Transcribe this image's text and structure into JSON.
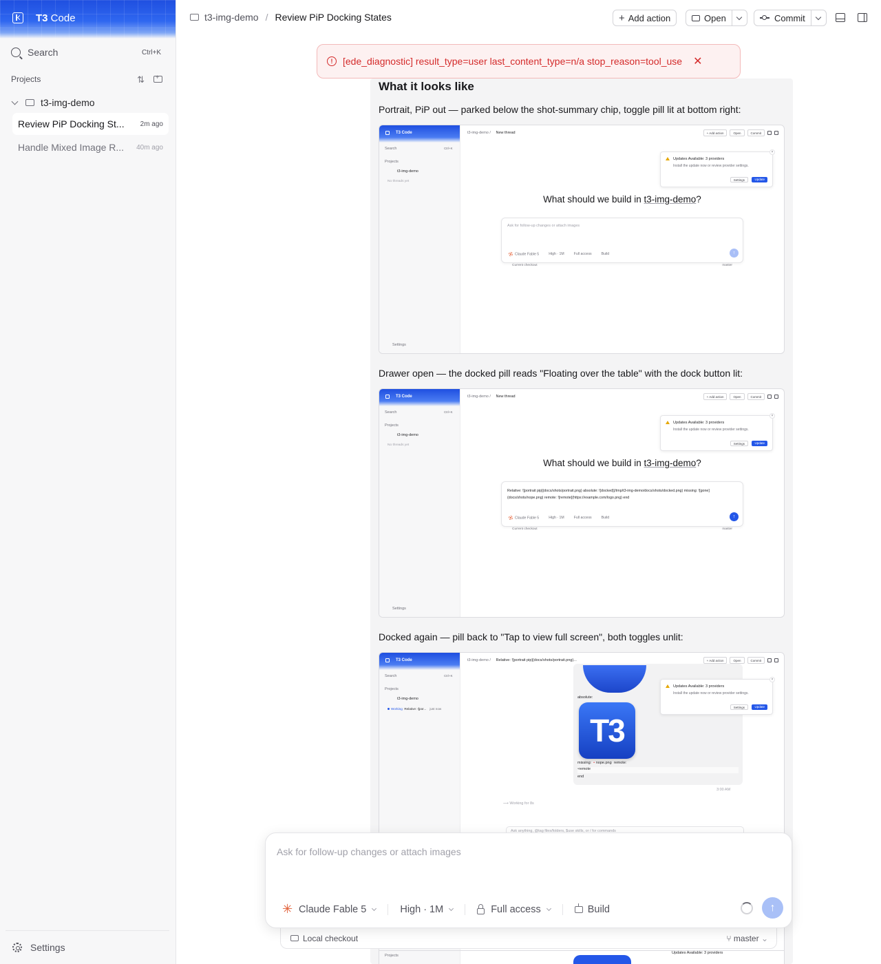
{
  "app": {
    "name_bold": "T3",
    "name_rest": " Code"
  },
  "sidebar": {
    "search_label": "Search",
    "search_shortcut": "Ctrl+K",
    "projects_label": "Projects",
    "project_name": "t3-img-demo",
    "threads": [
      {
        "title": "Review PiP Docking St...",
        "ago": "2m ago",
        "active": true
      },
      {
        "title": "Handle Mixed Image R...",
        "ago": "40m ago",
        "active": false
      }
    ],
    "settings_label": "Settings"
  },
  "header": {
    "crumb_project": "t3-img-demo",
    "crumb_sep": "/",
    "crumb_thread": "Review PiP Docking States",
    "add_action": "Add action",
    "open": "Open",
    "commit": "Commit"
  },
  "banner": {
    "icon": "!",
    "message": "[ede_diagnostic] result_type=user last_content_type=n/a stop_reason=tool_use",
    "close": "✕",
    "color": "#d42a2a"
  },
  "message": {
    "heading": "What it looks like",
    "captions": [
      "Portrait, PiP out — parked below the shot-summary chip, toggle pill lit at bottom right:",
      "Drawer open — the docked pill reads \"Floating over the table\" with the dock button lit:",
      "Docked again — pill back to \"Tap to view full screen\", both toggles unlit:"
    ]
  },
  "mini": {
    "brand": "T3 Code",
    "search": "Search",
    "shortcut": "Ctrl+K",
    "projects": "Projects",
    "project": "t3-img-demo",
    "no_threads": "No threads yet",
    "settings": "Settings",
    "crumb_project": "t3-img-demo",
    "crumb_new": "New thread",
    "crumb_relative": "Relative: ![portrait pip](docs/shots/portrait.png)...",
    "add_action": "+ Add action",
    "open": "Open",
    "commit": "Commit",
    "toast_title": "Updates Available: 3 providers",
    "toast_body": "Install the update now or review provider settings.",
    "toast_settings": "Settings",
    "toast_update": "Update",
    "question_prefix": "What should we build in ",
    "question_project": "t3-img-demo",
    "question_suffix": "?",
    "composer_placeholder": "Ask for follow-up changes or attach images",
    "composer_text": "Relative: ![portrait pip](docs/shots/portrait.png) absolute: ![docked](/tmp/t3-img-demo/docs/shots/docked.png) missing: ![gone](docs/shots/nope.png) remote: ![remote](https://example.com/logo.png) end",
    "model": "Claude Fable 5",
    "effort": "High · 1M",
    "access": "Full access",
    "mode": "Build",
    "checkout": "Current checkout",
    "branch": "master",
    "working_label": "Working",
    "working_thread": "Relative: ![por...",
    "working_ago": "just now",
    "absolute": "absolute:",
    "missing": "missing:",
    "nope": "nope.png",
    "remote": "remote:",
    "remote_alt": "remote",
    "end": "end",
    "logo": "T3",
    "time": "3:00 AM",
    "working_for": "Working for 8s",
    "ask_anything": "Ask anything, @tag files/folders, $use skills, or / for commands"
  },
  "composer": {
    "placeholder": "Ask for follow-up changes or attach images",
    "model": "Claude Fable 5",
    "effort": "High · 1M",
    "access": "Full access",
    "mode": "Build",
    "send": "↑"
  },
  "footer": {
    "checkout": "Local checkout",
    "branch": "master"
  },
  "colors": {
    "accent": "#2457e8",
    "brand_gradient_top": "#1f4fe0",
    "error": "#d42a2a"
  }
}
